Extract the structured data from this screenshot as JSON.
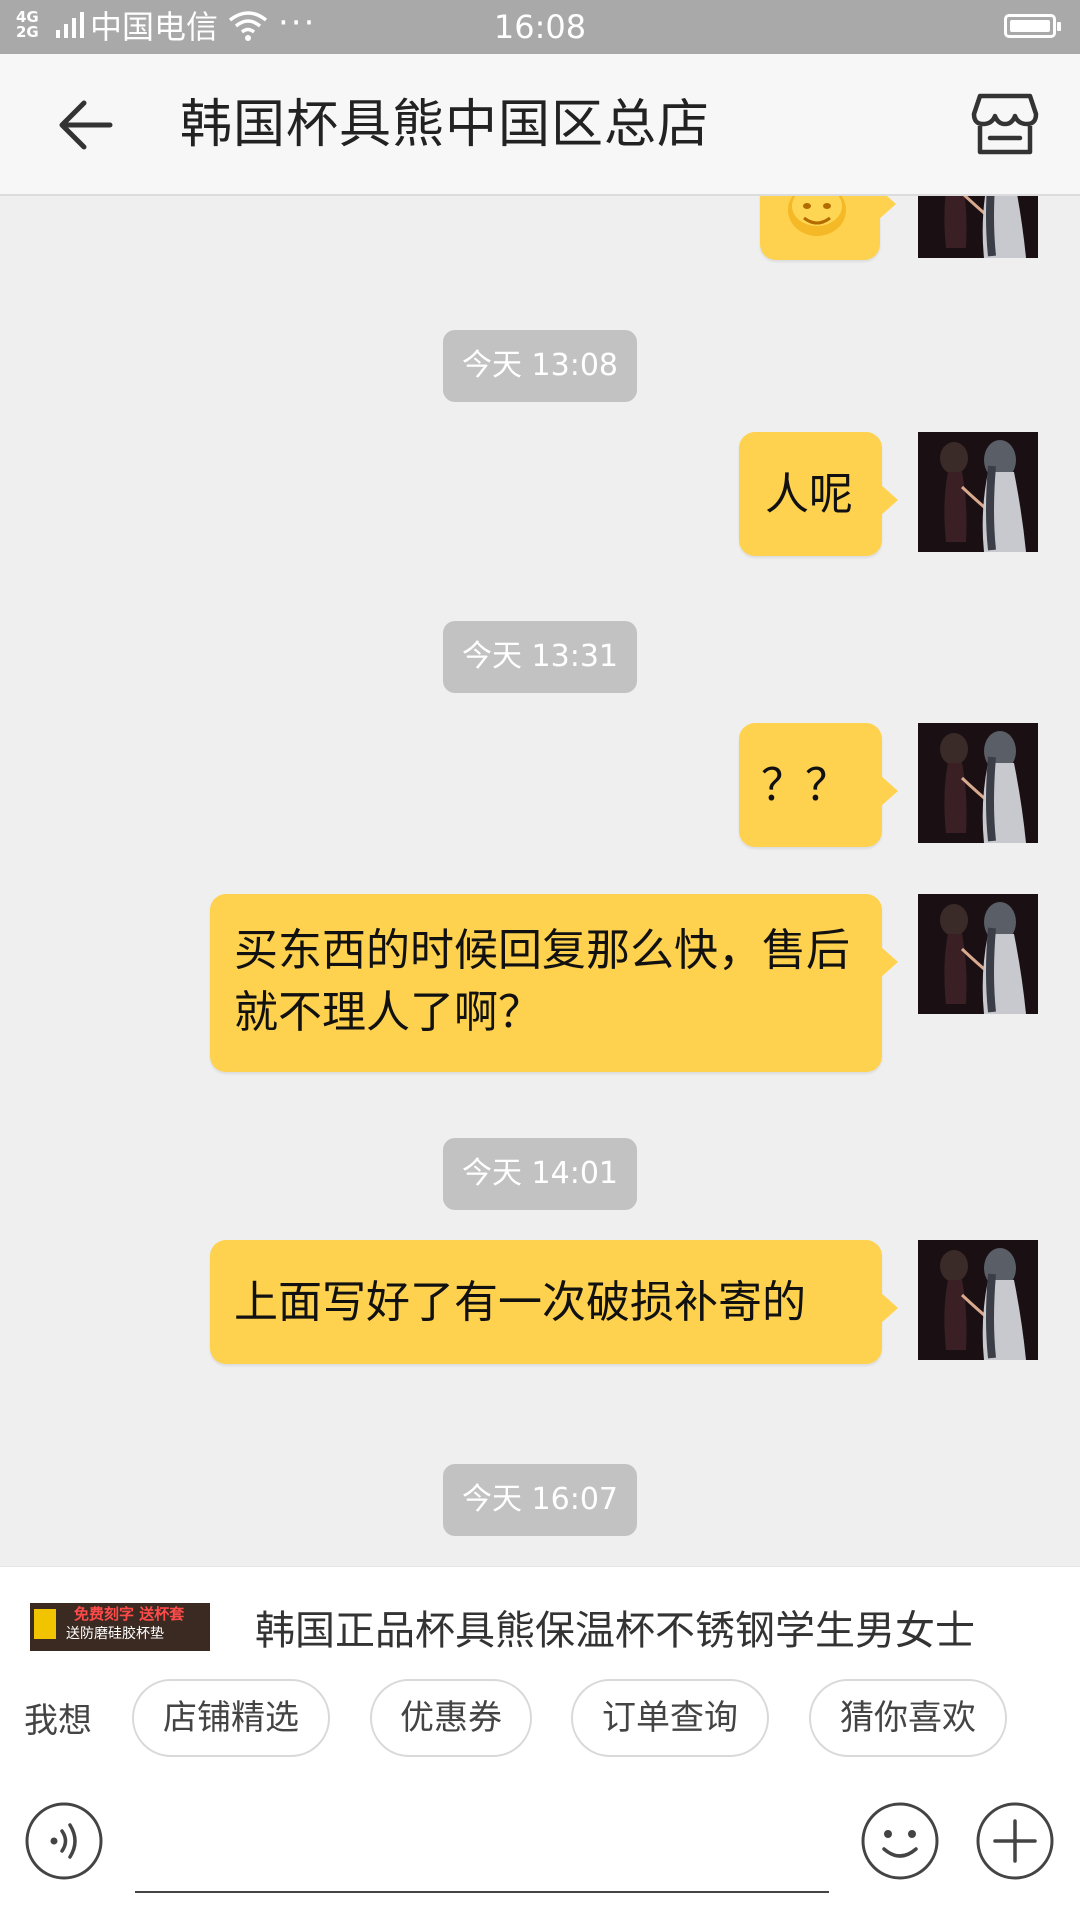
{
  "status_bar": {
    "network": "4G 2G",
    "carrier": "中国电信",
    "more": "···",
    "time": "16:08"
  },
  "header": {
    "title": "韩国杯具熊中国区总店",
    "back_icon": "arrow-left-icon",
    "shop_icon": "store-icon"
  },
  "chat": {
    "messages": [
      {
        "type": "emoji",
        "emoji": "🙂"
      },
      {
        "type": "timestamp",
        "text": "今天 13:08"
      },
      {
        "type": "text",
        "text": "人呢"
      },
      {
        "type": "timestamp",
        "text": "今天 13:31"
      },
      {
        "type": "text",
        "text": "？？"
      },
      {
        "type": "text",
        "text": "买东西的时候回复那么快，售后就不理人了啊？"
      },
      {
        "type": "timestamp",
        "text": "今天 14:01"
      },
      {
        "type": "text",
        "text": "上面写好了有一次破损补寄的"
      },
      {
        "type": "timestamp",
        "text": "今天 16:07"
      }
    ]
  },
  "product": {
    "thumb_line1": "免费刻字 送杯套",
    "thumb_line2": "送防磨硅胶杯垫",
    "title": "韩国正品杯具熊保温杯不锈钢学生男女士"
  },
  "quick_actions": {
    "label": "我想",
    "chips": [
      "店铺精选",
      "优惠券",
      "订单查询",
      "猜你喜欢"
    ]
  },
  "input_bar": {
    "voice_icon": "voice-icon",
    "emoji_icon": "smiley-icon",
    "plus_icon": "plus-icon"
  },
  "colors": {
    "bubble": "#fed24e",
    "timestamp_bg": "#c2c2c2",
    "chat_bg": "#efefef",
    "status_bar_bg": "#a9a9a9"
  }
}
